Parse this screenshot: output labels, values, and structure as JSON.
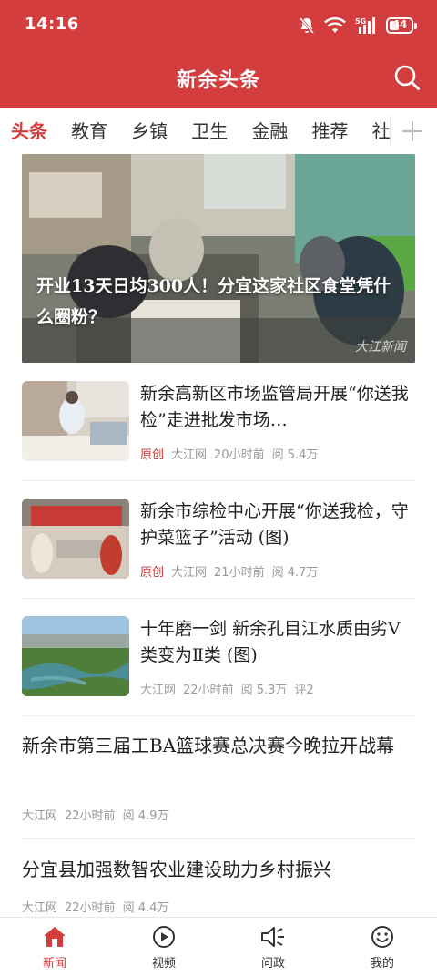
{
  "status_bar": {
    "time": "14:16",
    "battery": "44",
    "icons": [
      "bell-muted-icon",
      "wifi-icon",
      "signal-5g-icon",
      "battery-icon"
    ]
  },
  "header": {
    "title": "新余头条",
    "search_icon": "search-icon"
  },
  "tabs": [
    {
      "label": "头条",
      "active": true
    },
    {
      "label": "教育",
      "active": false
    },
    {
      "label": "乡镇",
      "active": false
    },
    {
      "label": "卫生",
      "active": false
    },
    {
      "label": "金融",
      "active": false
    },
    {
      "label": "推荐",
      "active": false
    },
    {
      "label": "社",
      "active": false
    }
  ],
  "tab_add_icon": "plus-icon",
  "hero": {
    "title": "开业13天日均300人！分宜这家社区食堂凭什么圈粉？",
    "watermark": "大江新闻"
  },
  "news": [
    {
      "title": "新余高新区市场监管局开展“你送我检”走进批发市场…",
      "tag": "原创",
      "source": "大江网",
      "time": "20小时前",
      "views": "阅 5.4万",
      "comments": ""
    },
    {
      "title": "新余市综检中心开展“你送我检，守护菜篮子”活动 (图)",
      "tag": "原创",
      "source": "大江网",
      "time": "21小时前",
      "views": "阅 4.7万",
      "comments": ""
    },
    {
      "title": "十年磨一剑  新余孔目江水质由劣V类变为Ⅱ类 (图)",
      "tag": "",
      "source": "大江网",
      "time": "22小时前",
      "views": "阅 5.3万",
      "comments": "评2"
    }
  ],
  "wide_news": [
    {
      "title": "新余市第三届工BA篮球赛总决赛今晚拉开战幕",
      "source": "大江网",
      "time": "22小时前",
      "views": "阅 4.9万"
    },
    {
      "title": "分宜县加强数智农业建设助力乡村振兴",
      "source": "大江网",
      "time": "22小时前",
      "views": "阅 4.4万"
    }
  ],
  "bottom_nav": [
    {
      "label": "新闻",
      "icon": "home-icon",
      "active": true
    },
    {
      "label": "视频",
      "icon": "play-icon",
      "active": false
    },
    {
      "label": "问政",
      "icon": "speaker-icon",
      "active": false
    },
    {
      "label": "我的",
      "icon": "smile-icon",
      "active": false
    }
  ],
  "colors": {
    "brand_red": "#d43d3d",
    "tag_red": "#c33333",
    "meta_gray": "#999999"
  }
}
